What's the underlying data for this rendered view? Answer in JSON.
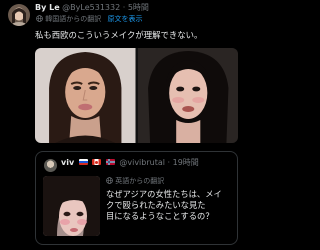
{
  "post": {
    "display_name": "By Le",
    "handle": "@ByLe531332",
    "separator": "·",
    "time": "5時間",
    "translated_from": "韓国語からの翻訳",
    "show_original": "原文を表示",
    "text": "私も西欧のこういうメイクが理解できない。",
    "photos": [
      {
        "icon": "photo-woman-western-makeup"
      },
      {
        "icon": "photo-woman-asian-makeup"
      }
    ]
  },
  "quote": {
    "display_name": "viv",
    "flags": [
      "flag-russia-icon",
      "flag-canada-icon",
      "flag-norway-icon"
    ],
    "handle": "@vivibrutal",
    "separator": "·",
    "time": "19時間",
    "translated_from": "英語からの翻訳",
    "text_lines": [
      "なぜアジアの女性たちは、メイ",
      "クで殴られたみたいな見た",
      "目になるようなことするの？"
    ]
  },
  "colors": {
    "background": "#000000",
    "text": "#e7e9ea",
    "muted": "#71767b",
    "link": "#1d9bf0",
    "border": "#2f3336"
  }
}
